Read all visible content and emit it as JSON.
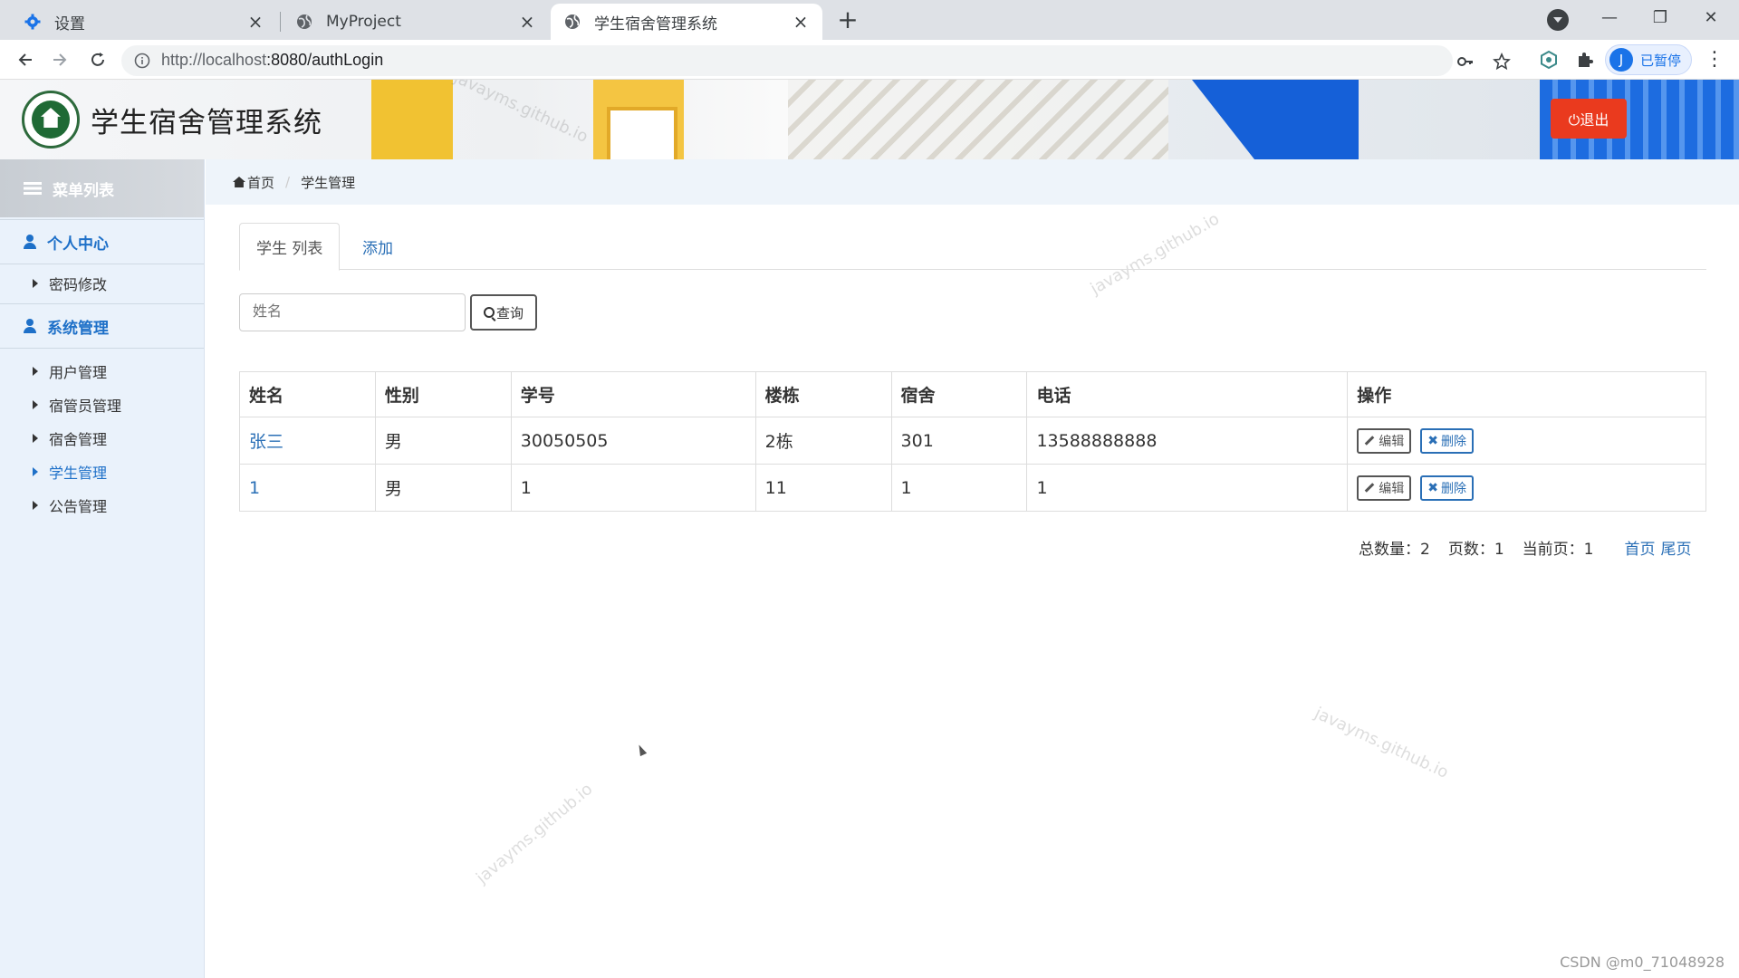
{
  "browser": {
    "tabs": [
      {
        "label": "设置",
        "icon": "gear-icon"
      },
      {
        "label": "MyProject",
        "icon": "globe-icon"
      },
      {
        "label": "学生宿舍管理系统",
        "icon": "globe-icon"
      }
    ],
    "url_host": "http://localhost",
    "url_rest": ":8080/authLogin",
    "profile_initial": "J",
    "profile_status": "已暂停"
  },
  "header": {
    "title": "学生宿舍管理系统",
    "logout_label": "⏻退出",
    "watermark": "javayms.github.io"
  },
  "sidebar": {
    "menu_title": "菜单列表",
    "groups": [
      {
        "label": "个人中心",
        "items": [
          {
            "label": "密码修改"
          }
        ]
      },
      {
        "label": "系统管理",
        "items": [
          {
            "label": "用户管理"
          },
          {
            "label": "宿管员管理"
          },
          {
            "label": "宿舍管理"
          },
          {
            "label": "学生管理",
            "active": true
          },
          {
            "label": "公告管理"
          }
        ]
      }
    ]
  },
  "breadcrumb": {
    "home": "首页",
    "current": "学生管理"
  },
  "tabs": {
    "list": "学生 列表",
    "add": "添加"
  },
  "search": {
    "placeholder": "姓名",
    "button": "查询"
  },
  "table": {
    "columns": [
      "姓名",
      "性别",
      "学号",
      "楼栋",
      "宿舍",
      "电话",
      "操作"
    ],
    "rows": [
      {
        "name": "张三",
        "gender": "男",
        "student_id": "30050505",
        "building": "2栋",
        "room": "301",
        "phone": "13588888888"
      },
      {
        "name": "1",
        "gender": "男",
        "student_id": "1",
        "building": "11",
        "room": "1",
        "phone": "1"
      }
    ],
    "edit_label": "编辑",
    "delete_label": "删除"
  },
  "pager": {
    "total_label": "总数量：2",
    "pages_label": "页数：1",
    "current_label": "当前页：1",
    "first": "首页",
    "last": "尾页"
  },
  "footer_credit": "CSDN @m0_71048928"
}
